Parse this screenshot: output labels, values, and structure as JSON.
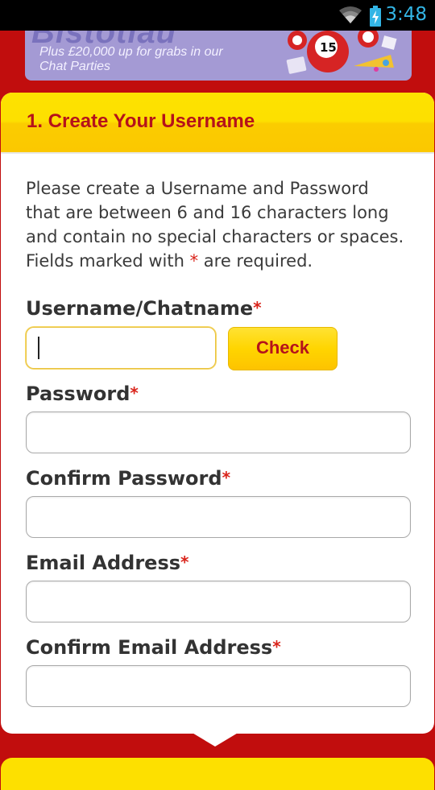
{
  "status_bar": {
    "time": "3:48"
  },
  "promo": {
    "tagline": "Plus £20,000 up for grabs in our Chat Parties",
    "ball_number": "15",
    "colors": {
      "background": "#a49ad4",
      "ball": "#d62424"
    }
  },
  "section": {
    "title": "1.  Create Your Username",
    "intro_before": "Please create a Username and Password that are between 6 and 16 characters long and contain no special characters or spaces. Fields marked with ",
    "intro_asterisk": "*",
    "intro_after": " are required."
  },
  "form": {
    "required_marker": "*",
    "username_label": "Username/Chatname",
    "username_value": "",
    "check_label": "Check",
    "password_label": "Password",
    "password_value": "",
    "confirm_password_label": "Confirm Password",
    "confirm_password_value": "",
    "email_label": "Email Address",
    "email_value": "",
    "confirm_email_label": "Confirm Email Address",
    "confirm_email_value": ""
  },
  "colors": {
    "page_background": "#c10d0d",
    "header_yellow": "#fde000",
    "title_red": "#b5121b",
    "required_red": "#d9231a"
  },
  "icons": [
    "wifi-icon",
    "battery-charging-icon",
    "bingo-balls-icon"
  ]
}
